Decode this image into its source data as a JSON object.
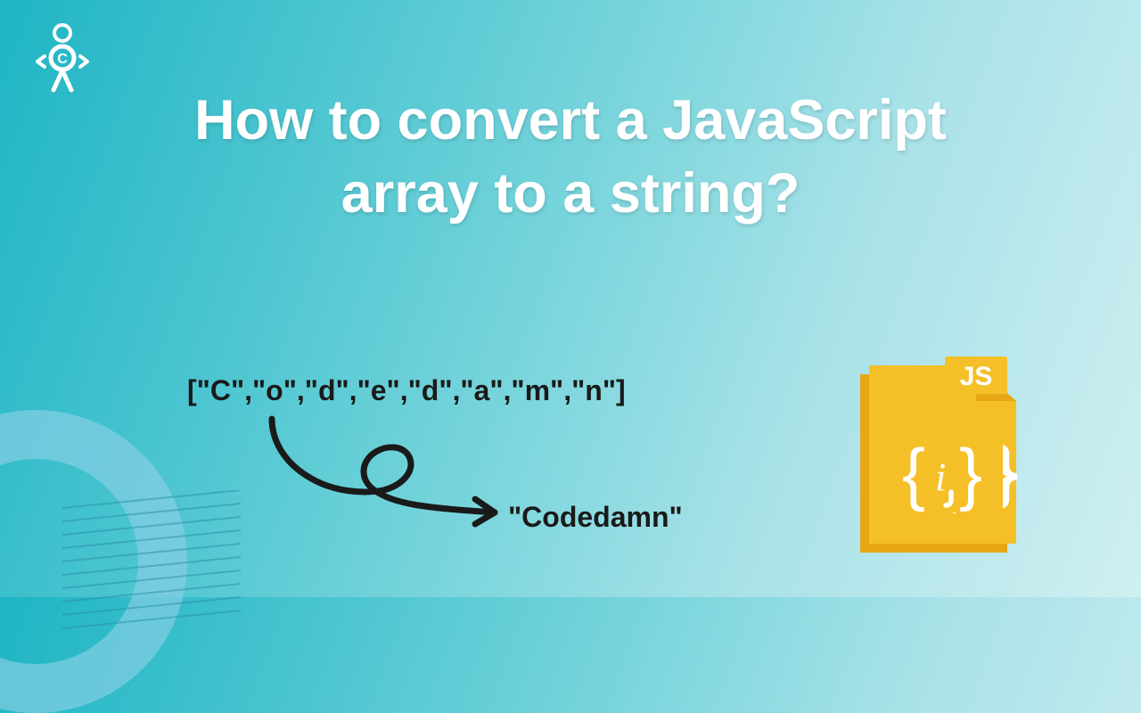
{
  "title": "How to convert a JavaScript array to a string?",
  "array_text": "[\"C\",\"o\",\"d\",\"e\",\"d\",\"a\",\"m\",\"n\"]",
  "result_text": "\"Codedamn\"",
  "js_label": "JS",
  "js_body": "{i}"
}
